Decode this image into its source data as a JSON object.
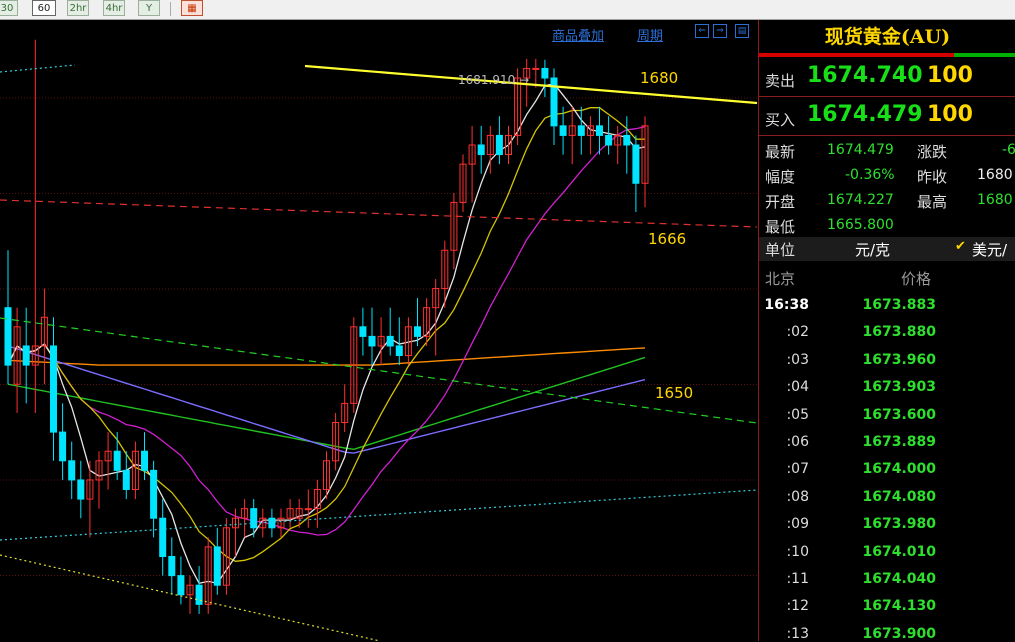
{
  "toolbar": {
    "buttons": [
      "30",
      "60",
      "2hr",
      "4hr",
      "Y"
    ],
    "active": "60"
  },
  "chart": {
    "links": [
      "商品叠加",
      "周期"
    ],
    "annotations": {
      "high_label": "1681.910 →",
      "level_1680": "1680",
      "level_1666": "1666",
      "level_1650": "1650"
    },
    "colors": {
      "up_candle": "#ff3030",
      "down_candle": "#00e5ff",
      "ma5": "#e6e6e6",
      "ma10": "#d4c400",
      "ma20": "#d020d0",
      "ma_orange": "#ff8c00",
      "ma_green": "#20c020",
      "ma_blue": "#7a6cff",
      "trend_yellow": "#ffff30"
    }
  },
  "chart_data": {
    "type": "candlestick",
    "y_axis": {
      "min": 1634,
      "max": 1687,
      "grid": true
    },
    "candles": [
      {
        "o": 1656,
        "h": 1662,
        "l": 1648,
        "c": 1650
      },
      {
        "o": 1648,
        "h": 1656,
        "l": 1645,
        "c": 1654
      },
      {
        "o": 1652,
        "h": 1656,
        "l": 1646,
        "c": 1650
      },
      {
        "o": 1650,
        "h": 1684,
        "l": 1645,
        "c": 1652
      },
      {
        "o": 1652,
        "h": 1658,
        "l": 1648,
        "c": 1655
      },
      {
        "o": 1652,
        "h": 1655,
        "l": 1640,
        "c": 1643
      },
      {
        "o": 1643,
        "h": 1646,
        "l": 1638,
        "c": 1640
      },
      {
        "o": 1640,
        "h": 1642,
        "l": 1636,
        "c": 1638
      },
      {
        "o": 1638,
        "h": 1640,
        "l": 1634,
        "c": 1636
      },
      {
        "o": 1636,
        "h": 1640,
        "l": 1632,
        "c": 1638
      },
      {
        "o": 1638,
        "h": 1641,
        "l": 1635,
        "c": 1640
      },
      {
        "o": 1640,
        "h": 1643,
        "l": 1637,
        "c": 1641
      },
      {
        "o": 1641,
        "h": 1643,
        "l": 1638,
        "c": 1639
      },
      {
        "o": 1639,
        "h": 1641,
        "l": 1636,
        "c": 1637
      },
      {
        "o": 1637,
        "h": 1642,
        "l": 1636,
        "c": 1641
      },
      {
        "o": 1641,
        "h": 1643,
        "l": 1638,
        "c": 1639
      },
      {
        "o": 1639,
        "h": 1640,
        "l": 1632,
        "c": 1634
      },
      {
        "o": 1634,
        "h": 1636,
        "l": 1628,
        "c": 1630
      },
      {
        "o": 1630,
        "h": 1632,
        "l": 1626,
        "c": 1628
      },
      {
        "o": 1628,
        "h": 1630,
        "l": 1625,
        "c": 1626
      },
      {
        "o": 1626,
        "h": 1628,
        "l": 1624,
        "c": 1627
      },
      {
        "o": 1627,
        "h": 1629,
        "l": 1624,
        "c": 1625
      },
      {
        "o": 1625,
        "h": 1632,
        "l": 1624,
        "c": 1631
      },
      {
        "o": 1631,
        "h": 1633,
        "l": 1626,
        "c": 1627
      },
      {
        "o": 1627,
        "h": 1634,
        "l": 1626,
        "c": 1633
      },
      {
        "o": 1633,
        "h": 1635,
        "l": 1630,
        "c": 1634
      },
      {
        "o": 1634,
        "h": 1636,
        "l": 1632,
        "c": 1635
      },
      {
        "o": 1635,
        "h": 1636,
        "l": 1632,
        "c": 1633
      },
      {
        "o": 1633,
        "h": 1635,
        "l": 1632,
        "c": 1634
      },
      {
        "o": 1634,
        "h": 1635,
        "l": 1632,
        "c": 1633
      },
      {
        "o": 1633,
        "h": 1635,
        "l": 1632,
        "c": 1634
      },
      {
        "o": 1634,
        "h": 1636,
        "l": 1633,
        "c": 1635
      },
      {
        "o": 1634,
        "h": 1636,
        "l": 1633,
        "c": 1635
      },
      {
        "o": 1635,
        "h": 1637,
        "l": 1633,
        "c": 1635
      },
      {
        "o": 1635,
        "h": 1638,
        "l": 1633,
        "c": 1637
      },
      {
        "o": 1637,
        "h": 1641,
        "l": 1636,
        "c": 1640
      },
      {
        "o": 1640,
        "h": 1645,
        "l": 1639,
        "c": 1644
      },
      {
        "o": 1644,
        "h": 1648,
        "l": 1643,
        "c": 1646
      },
      {
        "o": 1646,
        "h": 1655,
        "l": 1645,
        "c": 1654
      },
      {
        "o": 1654,
        "h": 1656,
        "l": 1651,
        "c": 1653
      },
      {
        "o": 1653,
        "h": 1656,
        "l": 1650,
        "c": 1652
      },
      {
        "o": 1652,
        "h": 1655,
        "l": 1650,
        "c": 1653
      },
      {
        "o": 1653,
        "h": 1656,
        "l": 1651,
        "c": 1652
      },
      {
        "o": 1652,
        "h": 1655,
        "l": 1650,
        "c": 1651
      },
      {
        "o": 1651,
        "h": 1655,
        "l": 1650,
        "c": 1654
      },
      {
        "o": 1654,
        "h": 1657,
        "l": 1652,
        "c": 1653
      },
      {
        "o": 1653,
        "h": 1657,
        "l": 1652,
        "c": 1656
      },
      {
        "o": 1656,
        "h": 1659,
        "l": 1651,
        "c": 1658
      },
      {
        "o": 1658,
        "h": 1663,
        "l": 1656,
        "c": 1662
      },
      {
        "o": 1662,
        "h": 1668,
        "l": 1660,
        "c": 1667
      },
      {
        "o": 1667,
        "h": 1672,
        "l": 1666,
        "c": 1671
      },
      {
        "o": 1671,
        "h": 1675,
        "l": 1667,
        "c": 1673
      },
      {
        "o": 1673,
        "h": 1675,
        "l": 1670,
        "c": 1672
      },
      {
        "o": 1672,
        "h": 1675,
        "l": 1670,
        "c": 1674
      },
      {
        "o": 1674,
        "h": 1676,
        "l": 1671,
        "c": 1672
      },
      {
        "o": 1672,
        "h": 1675,
        "l": 1671,
        "c": 1674
      },
      {
        "o": 1674,
        "h": 1681,
        "l": 1673,
        "c": 1680
      },
      {
        "o": 1680,
        "h": 1682,
        "l": 1677,
        "c": 1681
      },
      {
        "o": 1681,
        "h": 1682,
        "l": 1679,
        "c": 1681
      },
      {
        "o": 1681,
        "h": 1681.9,
        "l": 1678,
        "c": 1680
      },
      {
        "o": 1680,
        "h": 1681,
        "l": 1673,
        "c": 1675
      },
      {
        "o": 1675,
        "h": 1677,
        "l": 1672,
        "c": 1674
      },
      {
        "o": 1674,
        "h": 1677,
        "l": 1671,
        "c": 1675
      },
      {
        "o": 1675,
        "h": 1677,
        "l": 1672,
        "c": 1674
      },
      {
        "o": 1674,
        "h": 1676,
        "l": 1672,
        "c": 1675
      },
      {
        "o": 1675,
        "h": 1677,
        "l": 1672,
        "c": 1674
      },
      {
        "o": 1674,
        "h": 1676,
        "l": 1672,
        "c": 1673
      },
      {
        "o": 1673,
        "h": 1675,
        "l": 1671,
        "c": 1674
      },
      {
        "o": 1674,
        "h": 1676,
        "l": 1670,
        "c": 1673
      },
      {
        "o": 1673,
        "h": 1674,
        "l": 1666,
        "c": 1669
      },
      {
        "o": 1669,
        "h": 1676,
        "l": 1666.5,
        "c": 1675
      }
    ],
    "horizontal_levels": [
      1680,
      1666,
      1650
    ]
  },
  "panel": {
    "title": "现货黄金(AU)",
    "sell_label": "卖出",
    "sell_price": "1674.740",
    "sell_vol": "100",
    "buy_label": "买入",
    "buy_price": "1674.479",
    "buy_vol": "100",
    "stats": {
      "latest_label": "最新",
      "latest": "1674.479",
      "change_label": "涨跌",
      "change": "-6",
      "range_label": "幅度",
      "range": "-0.36%",
      "prev_label": "昨收",
      "prev": "1680",
      "open_label": "开盘",
      "open": "1674.227",
      "high_label": "最高",
      "high": "1680",
      "low_label": "最低",
      "low": "1665.800"
    },
    "unit_label": "单位",
    "unit_value": "元/克",
    "unit_option": "美元/",
    "tick_header_time": "北京",
    "tick_header_price": "价格",
    "ticks": [
      {
        "time": "16:38",
        "price": "1673.883"
      },
      {
        "time": ":02",
        "price": "1673.880"
      },
      {
        "time": ":03",
        "price": "1673.960"
      },
      {
        "time": ":04",
        "price": "1673.903"
      },
      {
        "time": ":05",
        "price": "1673.600"
      },
      {
        "time": ":06",
        "price": "1673.889"
      },
      {
        "time": ":07",
        "price": "1674.000"
      },
      {
        "time": ":08",
        "price": "1674.080"
      },
      {
        "time": ":09",
        "price": "1673.980"
      },
      {
        "time": ":10",
        "price": "1674.010"
      },
      {
        "time": ":11",
        "price": "1674.040"
      },
      {
        "time": ":12",
        "price": "1674.130"
      },
      {
        "time": ":13",
        "price": "1673.900"
      }
    ]
  }
}
